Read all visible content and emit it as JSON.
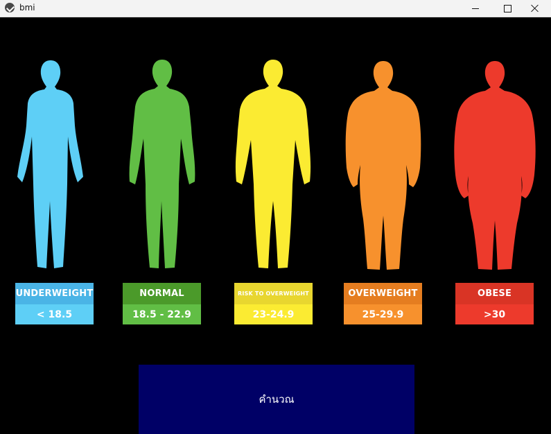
{
  "window": {
    "title": "bmi",
    "minimize_icon": "minimize-icon",
    "maximize_icon": "maximize-icon",
    "close_icon": "close-icon"
  },
  "categories": [
    {
      "label": "UNDERWEIGHT",
      "range": "< 18.5",
      "top_color": "#4ab4e6",
      "bottom_color": "#5ecff6",
      "figure_color": "#5ecff6"
    },
    {
      "label": "NORMAL",
      "range": "18.5 - 22.9",
      "top_color": "#4b9a2a",
      "bottom_color": "#61be45",
      "figure_color": "#61be45"
    },
    {
      "label": "RISK TO OVERWEIGHT",
      "range": "23-24.9",
      "top_color": "#e8d62f",
      "bottom_color": "#fbeb32",
      "figure_color": "#fbeb32"
    },
    {
      "label": "OVERWEIGHT",
      "range": "25-29.9",
      "top_color": "#e57d20",
      "bottom_color": "#f7912d",
      "figure_color": "#f7912d"
    },
    {
      "label": "OBESE",
      "range": ">30",
      "top_color": "#d93425",
      "bottom_color": "#ed3a2c",
      "figure_color": "#ed3a2c"
    }
  ],
  "calculate_button": {
    "label": "คำนวณ",
    "color": "#000066"
  }
}
